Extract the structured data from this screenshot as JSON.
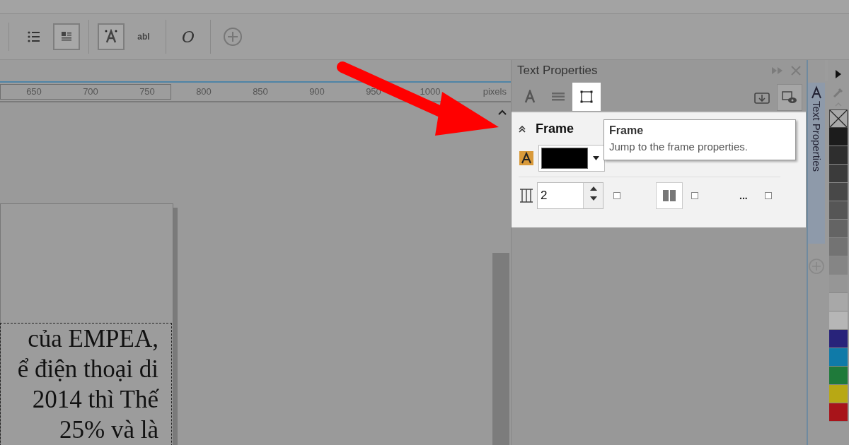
{
  "toolbar": {
    "buttons": [
      {
        "kind": "bullets",
        "pressed": false
      },
      {
        "kind": "dropcap",
        "pressed": true
      },
      {
        "kind": "frame-text",
        "pressed": true
      },
      {
        "kind": "glyph",
        "label": "abI",
        "pressed": false
      },
      {
        "kind": "glyph",
        "label": "O",
        "pressed": false
      },
      {
        "kind": "add",
        "pressed": false
      }
    ]
  },
  "ruler": {
    "labels": [
      "650",
      "700",
      "750",
      "800",
      "850",
      "900",
      "950",
      "1000"
    ],
    "unit": "pixels"
  },
  "canvas": {
    "text_lines": [
      "của EMPEA,",
      "ể điện thoại di",
      "2014 thì Thế",
      "25% và là"
    ]
  },
  "docker": {
    "title": "Text Properties",
    "tabs": [
      {
        "kind": "character",
        "selected": false
      },
      {
        "kind": "paragraph",
        "selected": false
      },
      {
        "kind": "frame",
        "selected": true
      }
    ],
    "section": {
      "title": "Frame",
      "expanded": true
    },
    "fill": {
      "color": "#000000"
    },
    "columns": {
      "value": "2"
    },
    "row2_checks": [
      {
        "checked": false
      },
      {
        "checked": false
      },
      {
        "checked": false
      }
    ],
    "more": "...",
    "tooltip": {
      "title": "Frame",
      "text": "Jump to the frame properties."
    },
    "side_tab": "Text Properties"
  },
  "palette": [
    {
      "color": "#1c1c1c"
    },
    {
      "color": "#2e2e2e"
    },
    {
      "color": "#3b3b3b"
    },
    {
      "color": "#484848"
    },
    {
      "color": "#565656"
    },
    {
      "color": "#646464"
    },
    {
      "color": "#737373"
    },
    {
      "color": "#858585"
    },
    {
      "color": "#969696"
    },
    {
      "color": "#a8a8a8"
    },
    {
      "color": "#b6b6b6"
    },
    {
      "color": "#28237a"
    },
    {
      "color": "#0f7aa8"
    },
    {
      "color": "#1f7a3a"
    },
    {
      "color": "#b8a814"
    },
    {
      "color": "#a8141a"
    }
  ]
}
